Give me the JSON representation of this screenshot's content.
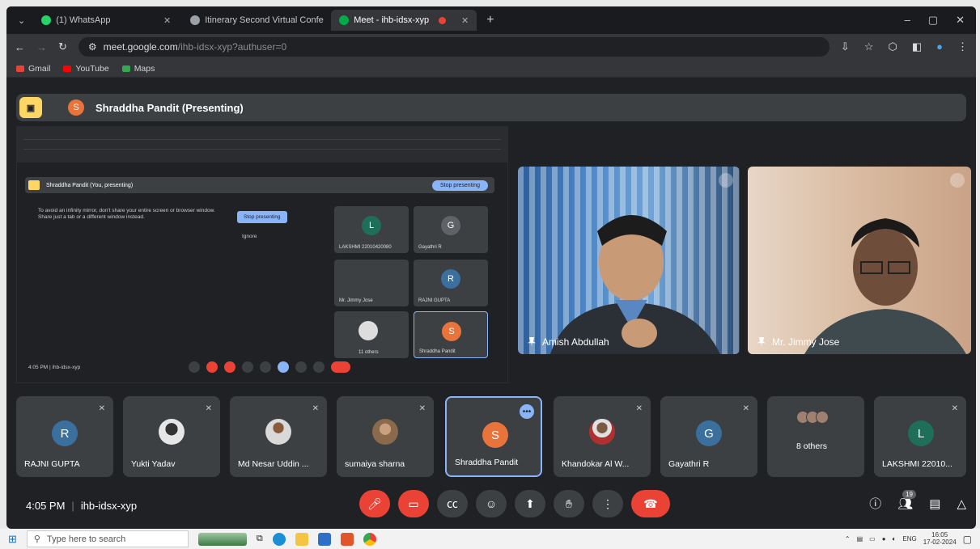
{
  "browser": {
    "tabs": [
      {
        "title": "(1) WhatsApp",
        "active": false,
        "favicon_color": "#25d366"
      },
      {
        "title": "Itinerary Second Virtual Confe",
        "active": false,
        "favicon_color": "#9aa0a6"
      },
      {
        "title": "Meet - ihb-idsx-xyp",
        "active": true,
        "favicon_color": "#00ac47"
      }
    ],
    "address": {
      "host": "meet.google.com",
      "path": "/ihb-idsx-xyp?authuser=0"
    },
    "bookmarks": [
      {
        "label": "Gmail",
        "color": "#ea4335"
      },
      {
        "label": "YouTube",
        "color": "#ff0000"
      },
      {
        "label": "Maps",
        "color": "#34a853"
      }
    ]
  },
  "presenting": {
    "name": "Shraddha Pandit (Presenting)",
    "avatar_letter": "S"
  },
  "shared_screen": {
    "bar_text": "Shraddha Pandit (You, presenting)",
    "stop_button": "Stop presenting",
    "message": "To avoid an infinity mirror, don't share your entire screen or browser window. Share just a tab or a different window instead.",
    "stop_button_2": "Stop presenting",
    "ignore": "Ignore",
    "tiles": [
      {
        "letter": "L",
        "name": "LAKSHMI 22010420080",
        "color": "#1e6e5a"
      },
      {
        "letter": "G",
        "name": "Gayathri R",
        "color": "#5f6368"
      },
      {
        "letter": "",
        "name": "Mr. Jimmy Jose",
        "color": "#3c4043"
      },
      {
        "letter": "R",
        "name": "RAJNI GUPTA",
        "color": "#3b6f9e"
      },
      {
        "letter": "",
        "name": "11 others",
        "color": "#3c4043"
      },
      {
        "letter": "S",
        "name": "Shraddha Pandit",
        "color": "#e8743b"
      }
    ],
    "footer": "4:05 PM | ihb-idsx-xyp"
  },
  "videos": [
    {
      "name": "Amish Abdullah"
    },
    {
      "name": "Mr. Jimmy Jose"
    }
  ],
  "participants": [
    {
      "name": "RAJNI GUPTA",
      "letter": "R",
      "color": "#3b6f9e",
      "type": "letter"
    },
    {
      "name": "Yukti Yadav",
      "letter": "",
      "color": "#e6e6e6",
      "type": "photo"
    },
    {
      "name": "Md Nesar Uddin ...",
      "letter": "",
      "color": "#d9d9d9",
      "type": "photo"
    },
    {
      "name": "sumaiya sharna",
      "letter": "",
      "color": "#8a6a4a",
      "type": "photo"
    },
    {
      "name": "Shraddha Pandit",
      "letter": "S",
      "color": "#e8743b",
      "type": "letter",
      "selected": true
    },
    {
      "name": "Khandokar Al W...",
      "letter": "",
      "color": "#b03030",
      "type": "photo"
    },
    {
      "name": "Gayathri R",
      "letter": "G",
      "color": "#3b6f9e",
      "type": "letter"
    },
    {
      "name": "8 others",
      "letter": "",
      "color": "#a08070",
      "type": "stack"
    },
    {
      "name": "LAKSHMI 22010...",
      "letter": "L",
      "color": "#1e6e5a",
      "type": "letter"
    }
  ],
  "controls": {
    "time": "4:05 PM",
    "meeting_code": "ihb-idsx-xyp",
    "participant_count": "19"
  },
  "taskbar": {
    "search_placeholder": "Type here to search",
    "language": "ENG",
    "time": "16:05",
    "date": "17-02-2024"
  }
}
